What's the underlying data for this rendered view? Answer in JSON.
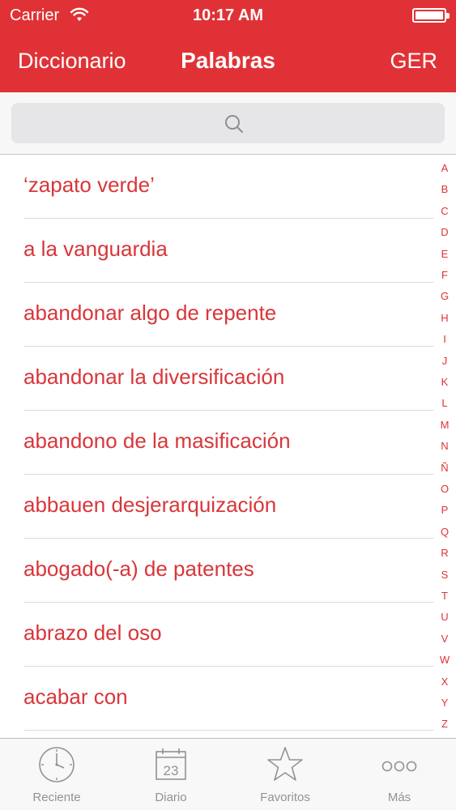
{
  "status_bar": {
    "carrier": "Carrier",
    "time": "10:17 AM"
  },
  "nav": {
    "left_label": "Diccionario",
    "title": "Palabras",
    "right_label": "GER"
  },
  "search": {
    "placeholder": ""
  },
  "entries": [
    {
      "label": "‘zapato verde’"
    },
    {
      "label": "a la vanguardia"
    },
    {
      "label": "abandonar algo de repente"
    },
    {
      "label": "abandonar la diversificación"
    },
    {
      "label": "abandono de la masificación"
    },
    {
      "label": "abbauen desjerarquización"
    },
    {
      "label": "abogado(-a) de patentes"
    },
    {
      "label": "abrazo del oso"
    },
    {
      "label": "acabar con"
    }
  ],
  "index_letters": [
    "A",
    "B",
    "C",
    "D",
    "E",
    "F",
    "G",
    "H",
    "I",
    "J",
    "K",
    "L",
    "M",
    "N",
    "Ñ",
    "O",
    "P",
    "Q",
    "R",
    "S",
    "T",
    "U",
    "V",
    "W",
    "X",
    "Y",
    "Z"
  ],
  "tabs": [
    {
      "label": "Reciente",
      "icon": "clock-icon"
    },
    {
      "label": "Diario",
      "icon": "calendar-icon",
      "icon_text": "23"
    },
    {
      "label": "Favoritos",
      "icon": "star-icon"
    },
    {
      "label": "Más",
      "icon": "more-icon"
    }
  ],
  "colors": {
    "accent": "#e03236",
    "entry_text": "#d8363a",
    "tab_inactive": "#929292"
  }
}
